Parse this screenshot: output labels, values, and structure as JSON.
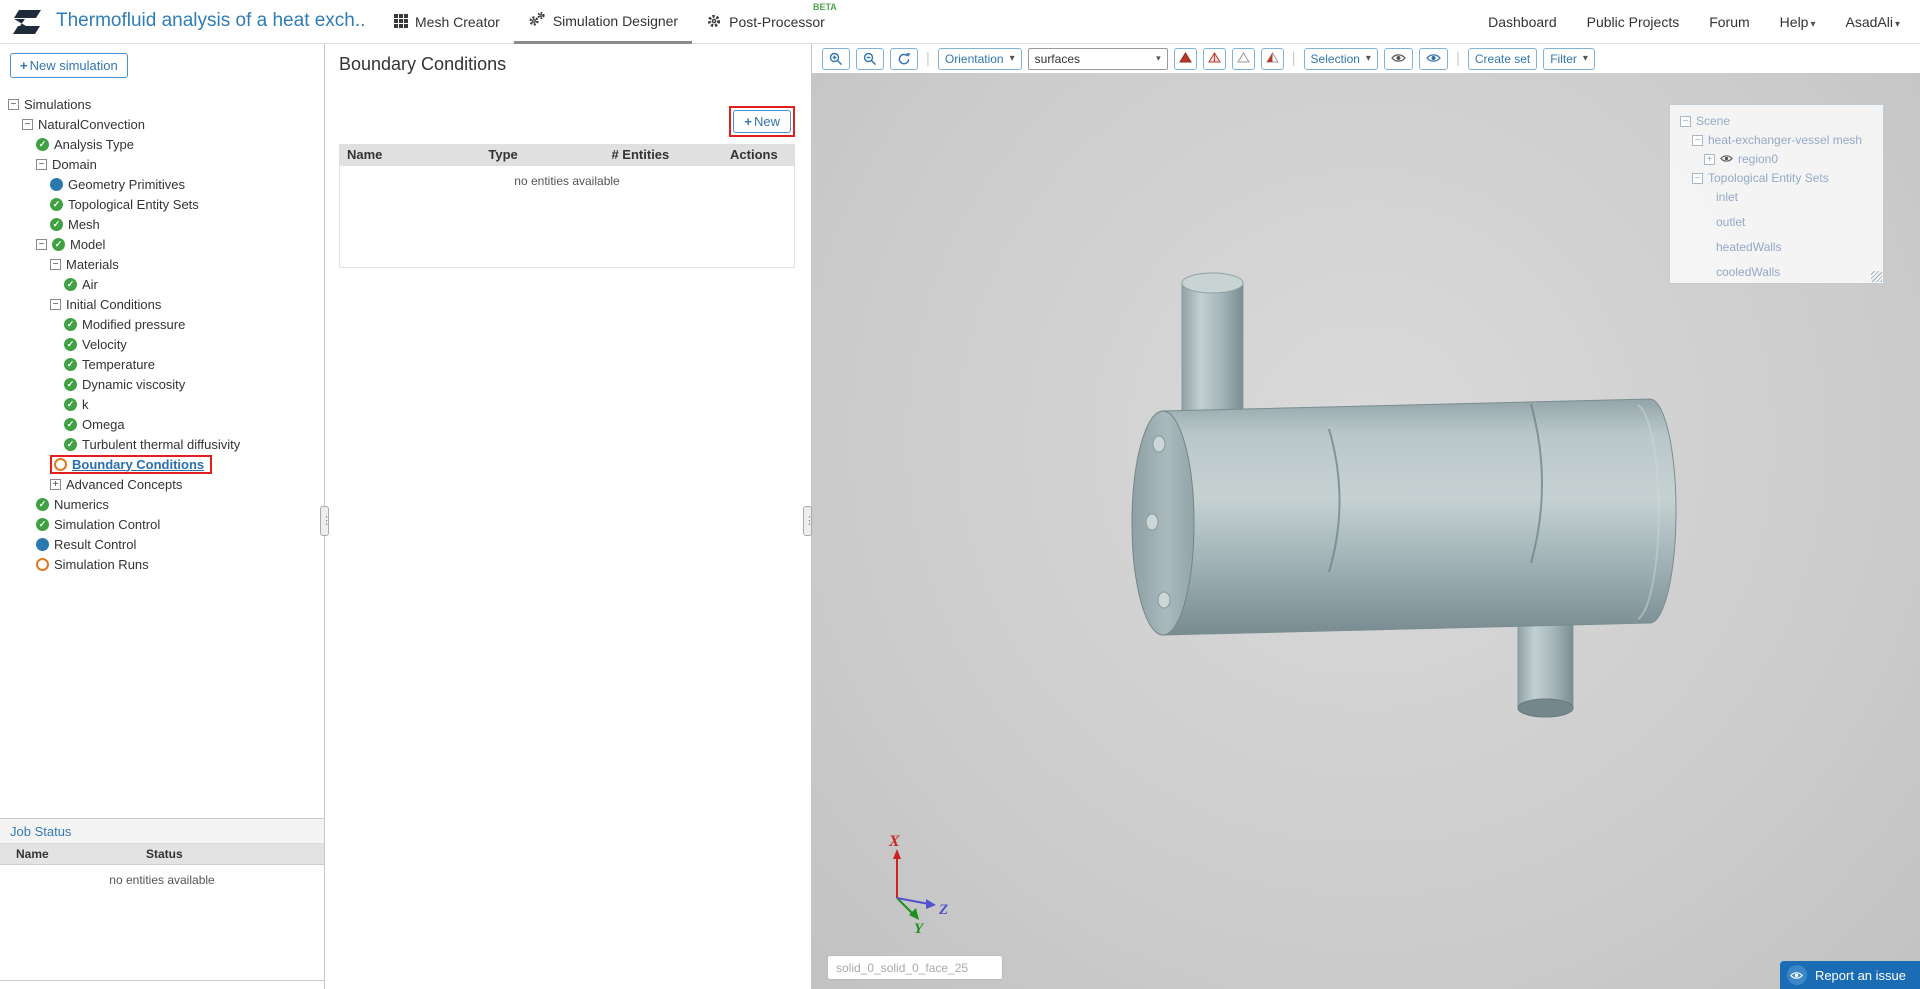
{
  "glyphs": {
    "plus": "+",
    "caret_down": "▾",
    "collapse": "−",
    "expand": "+",
    "ellipsis_grip": "⋮",
    "separator": "|"
  },
  "header": {
    "title": "Thermofluid analysis of a heat exch...",
    "nav": [
      {
        "label": "Mesh Creator"
      },
      {
        "label": "Simulation Designer"
      },
      {
        "label": "Post-Processor",
        "badge": "BETA"
      }
    ],
    "right_nav": [
      "Dashboard",
      "Public Projects",
      "Forum",
      "Help",
      "AsadAli"
    ]
  },
  "sidebar": {
    "new_simulation_label": "New simulation",
    "tree": [
      {
        "label": "Simulations",
        "level": 0,
        "expander": "minus"
      },
      {
        "label": "NaturalConvection",
        "level": 1,
        "expander": "minus"
      },
      {
        "label": "Analysis Type",
        "level": 2,
        "icon": "check"
      },
      {
        "label": "Domain",
        "level": 2,
        "expander": "minus"
      },
      {
        "label": "Geometry Primitives",
        "level": 3,
        "icon": "blue-dot"
      },
      {
        "label": "Topological Entity Sets",
        "level": 3,
        "icon": "check"
      },
      {
        "label": "Mesh",
        "level": 3,
        "icon": "check"
      },
      {
        "label": "Model",
        "level": 2,
        "expander": "minus",
        "icon": "check"
      },
      {
        "label": "Materials",
        "level": 3,
        "expander": "minus"
      },
      {
        "label": "Air",
        "level": 4,
        "icon": "check"
      },
      {
        "label": "Initial Conditions",
        "level": 3,
        "expander": "minus"
      },
      {
        "label": "Modified pressure",
        "level": 4,
        "icon": "check"
      },
      {
        "label": "Velocity",
        "level": 4,
        "icon": "check"
      },
      {
        "label": "Temperature",
        "level": 4,
        "icon": "check"
      },
      {
        "label": "Dynamic viscosity",
        "level": 4,
        "icon": "check"
      },
      {
        "label": "k",
        "level": 4,
        "icon": "check"
      },
      {
        "label": "Omega",
        "level": 4,
        "icon": "check"
      },
      {
        "label": "Turbulent thermal diffusivity",
        "level": 4,
        "icon": "check"
      },
      {
        "label": "Boundary Conditions",
        "level": 3,
        "icon": "orange-circle",
        "highlighted": true
      },
      {
        "label": "Advanced Concepts",
        "level": 3,
        "expander": "plus"
      },
      {
        "label": "Numerics",
        "level": 2,
        "icon": "check"
      },
      {
        "label": "Simulation Control",
        "level": 2,
        "icon": "check"
      },
      {
        "label": "Result Control",
        "level": 2,
        "icon": "blue-dot"
      },
      {
        "label": "Simulation Runs",
        "level": 2,
        "icon": "orange-circle"
      }
    ],
    "job_status": {
      "title": "Job Status",
      "columns": [
        "Name",
        "Status"
      ],
      "empty_text": "no entities available"
    }
  },
  "panel": {
    "title": "Boundary Conditions",
    "new_button_label": "New",
    "table": {
      "columns": [
        "Name",
        "Type",
        "# Entities",
        "Actions"
      ],
      "empty_text": "no entities available"
    }
  },
  "viewport": {
    "toolbar": {
      "orientation_label": "Orientation",
      "surfaces_value": "surfaces",
      "selection_label": "Selection",
      "create_set_label": "Create set",
      "filter_label": "Filter"
    },
    "scene_tree": {
      "root_label": "Scene",
      "mesh_label": "heat-exchanger-vessel mesh",
      "region_label": "region0",
      "topo_label": "Topological Entity Sets",
      "sets": [
        "inlet",
        "outlet",
        "heatedWalls",
        "cooledWalls"
      ]
    },
    "face_input_value": "solid_0_solid_0_face_25",
    "axes": {
      "x": "X",
      "y": "Y",
      "z": "Z"
    },
    "report_button_label": "Report an issue"
  }
}
